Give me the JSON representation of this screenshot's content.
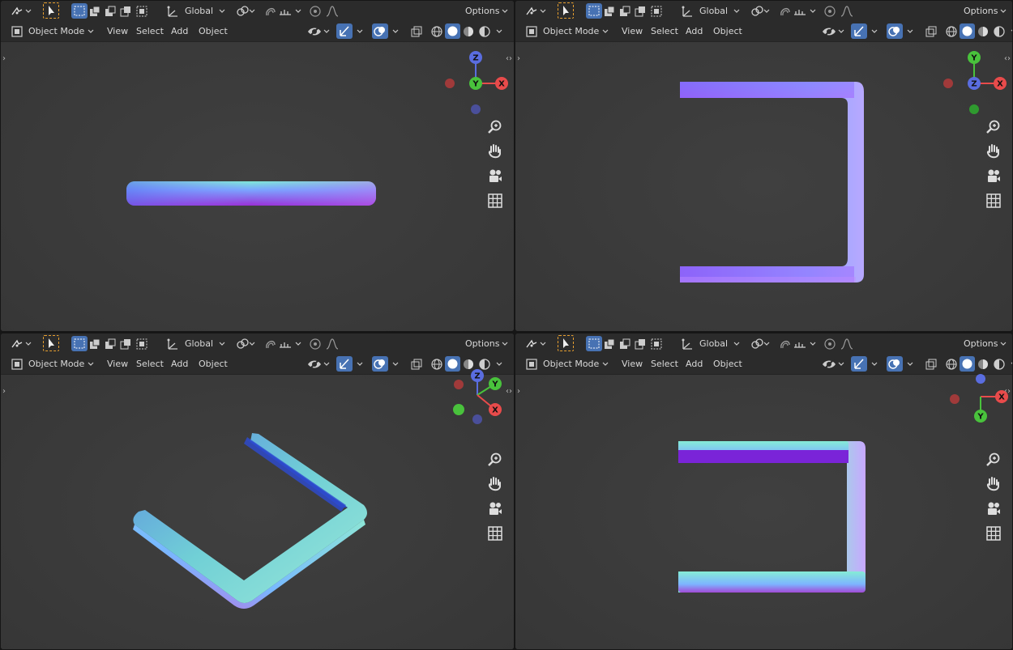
{
  "colors": {
    "bg": "#3a3a3a",
    "header": "#2b2b2b",
    "accent": "#4772b3",
    "axis_x": "#e84b4b",
    "axis_y": "#49c23c",
    "axis_z": "#5a6de0"
  },
  "header": {
    "orientation": "Global",
    "options_label": "Options",
    "mode": "Object Mode",
    "menus": [
      "View",
      "Select",
      "Add",
      "Object"
    ]
  },
  "viewports": [
    {
      "gizmo": {
        "top": "Z",
        "center": "Y",
        "right": "X"
      }
    },
    {
      "gizmo": {
        "top": "Y",
        "center": "Z",
        "right": "X"
      }
    },
    {
      "gizmo": {
        "top": "Z",
        "right_top": "Y",
        "right_bottom": "X"
      }
    },
    {
      "gizmo": {
        "right": "X",
        "bottom": "Y"
      }
    }
  ],
  "icons": [
    "snap-icon",
    "select-box-icon",
    "transform-pivot-icon",
    "link-icon",
    "proportional-icon",
    "falloff-icon",
    "visibility-icon",
    "gizmo-icon",
    "overlay-icon",
    "xray-icon",
    "wireframe-shading-icon",
    "solid-shading-icon",
    "material-shading-icon",
    "rendered-shading-icon",
    "zoom-icon",
    "pan-hand-icon",
    "camera-icon",
    "grid-icon"
  ]
}
